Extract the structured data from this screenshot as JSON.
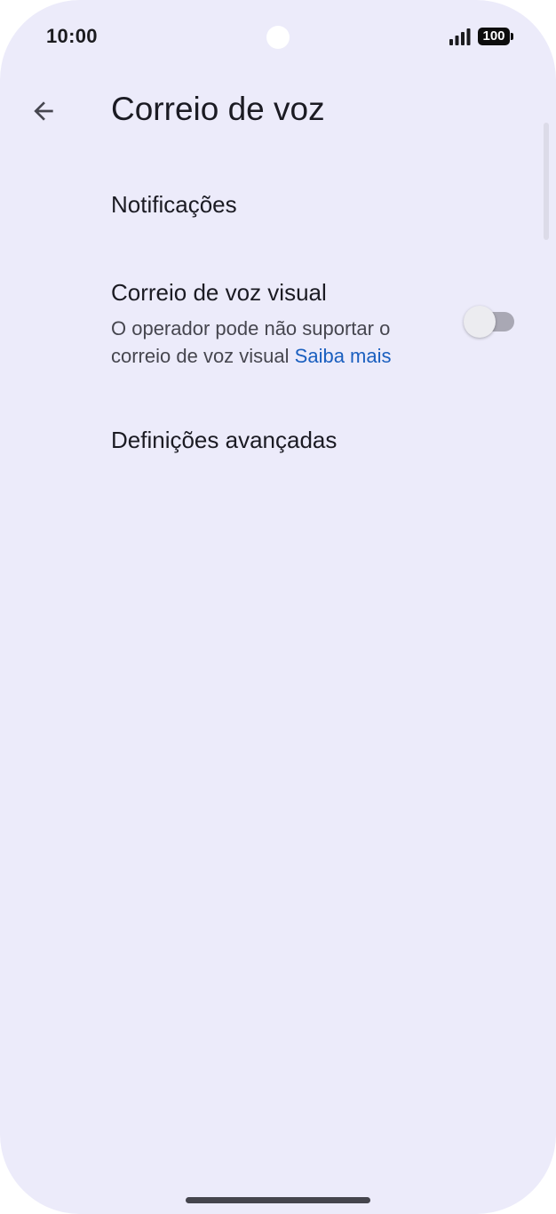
{
  "status_bar": {
    "time": "10:00",
    "battery": "100"
  },
  "app_bar": {
    "back_icon": "arrow-back-icon",
    "title": "Correio de voz"
  },
  "settings": {
    "notifications": {
      "title": "Notificações"
    },
    "visual_voicemail": {
      "title": "Correio de voz visual",
      "summary": "O operador pode não suportar o correio de voz visual",
      "link": "Saiba mais",
      "enabled": false
    },
    "advanced": {
      "title": "Definições avançadas"
    }
  },
  "colors": {
    "background": "#ECEBFA",
    "link": "#1a5fbf",
    "switch_off_track": "#a9a8b4"
  }
}
